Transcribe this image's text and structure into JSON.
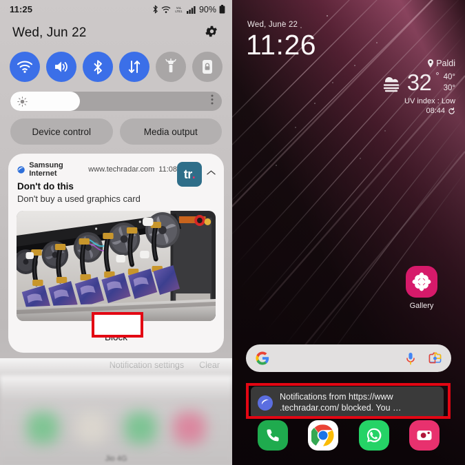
{
  "left_panel": {
    "statusbar": {
      "time": "11:25",
      "battery_text": "90%",
      "icons": [
        "bluetooth-icon",
        "wifi-icon",
        "volte-icon",
        "signal-icon",
        "battery-icon"
      ]
    },
    "date": "Wed, Jun 22",
    "settings_icon": "gear-icon",
    "toggles": [
      {
        "name": "wifi",
        "icon": "wifi-icon",
        "state": "on"
      },
      {
        "name": "sound",
        "icon": "speaker-icon",
        "state": "on"
      },
      {
        "name": "bluetooth",
        "icon": "bluetooth-icon",
        "state": "on"
      },
      {
        "name": "mobile-data",
        "icon": "data-arrows-icon",
        "state": "on"
      },
      {
        "name": "flashlight",
        "icon": "flashlight-icon",
        "state": "off"
      },
      {
        "name": "auto-rotate-lock",
        "icon": "lock-icon",
        "state": "off"
      }
    ],
    "brightness": {
      "icon": "brightness-icon",
      "percent": 33,
      "menu_icon": "more-vertical-icon"
    },
    "buttons": {
      "device_control": "Device control",
      "media_output": "Media output"
    },
    "notification": {
      "app_icon": "samsung-internet-icon",
      "app_name": "Samsung Internet",
      "url": "www.techradar.com",
      "time": "11:08",
      "title": "Don't do this",
      "body": "Don't buy a used graphics card",
      "logo_text": "tr",
      "logo_dot": ".",
      "collapse_icon": "chevron-up-icon",
      "image_alt": "gpu-mining-rig-photo",
      "action_label": "Block"
    },
    "footer": {
      "settings": "Notification settings",
      "clear": "Clear"
    },
    "carrier": "Jio 4G"
  },
  "right_panel": {
    "date": "Wed, June 22",
    "time": "11:26",
    "weather": {
      "location_icon": "location-pin-icon",
      "location": "Paldi",
      "condition_icon": "haze-icon",
      "temp": "32",
      "degree": "°",
      "high": "40°",
      "low": "30°",
      "uv": "UV index : Low",
      "updated": "08:44",
      "refresh_icon": "refresh-icon"
    },
    "gallery": {
      "icon": "gallery-flower-icon",
      "label": "Gallery"
    },
    "search": {
      "google_icon": "google-g-icon",
      "mic_icon": "microphone-icon",
      "lens_icon": "google-lens-icon",
      "value": "",
      "placeholder": ""
    },
    "toast": {
      "icon": "samsung-internet-icon",
      "line1": "Notifications from https://www",
      "line2": ".techradar.com/ blocked. You …"
    },
    "dock": [
      {
        "name": "phone",
        "icon": "phone-icon"
      },
      {
        "name": "chrome",
        "icon": "chrome-icon"
      },
      {
        "name": "whatsapp",
        "icon": "whatsapp-icon"
      },
      {
        "name": "camera",
        "icon": "camera-icon"
      }
    ]
  },
  "annotations": {
    "highlight_color": "#e30613",
    "boxes": [
      "block-button-highlight",
      "toast-highlight"
    ]
  }
}
